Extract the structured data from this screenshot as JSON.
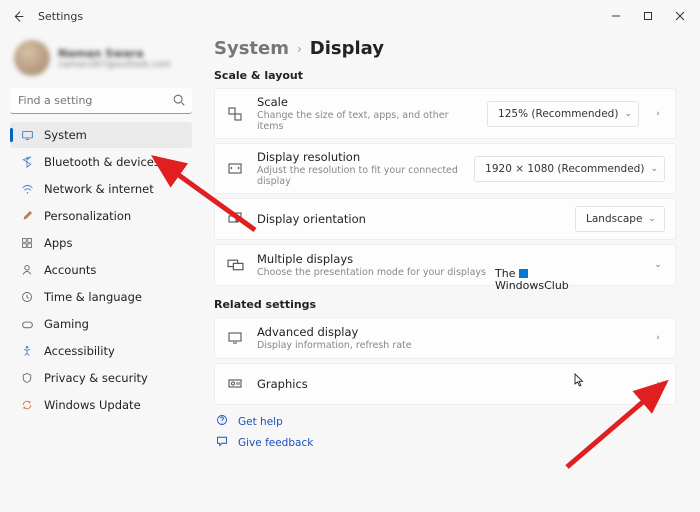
{
  "titlebar": {
    "title": "Settings"
  },
  "profile": {
    "name": "Naman Swara",
    "email": "naman267@outlook.com"
  },
  "search": {
    "placeholder": "Find a setting"
  },
  "nav": [
    {
      "label": "System"
    },
    {
      "label": "Bluetooth & devices"
    },
    {
      "label": "Network & internet"
    },
    {
      "label": "Personalization"
    },
    {
      "label": "Apps"
    },
    {
      "label": "Accounts"
    },
    {
      "label": "Time & language"
    },
    {
      "label": "Gaming"
    },
    {
      "label": "Accessibility"
    },
    {
      "label": "Privacy & security"
    },
    {
      "label": "Windows Update"
    }
  ],
  "breadcrumb": {
    "parent": "System",
    "current": "Display"
  },
  "sections": {
    "scale_layout": "Scale & layout",
    "related": "Related settings"
  },
  "cards": {
    "scale": {
      "title": "Scale",
      "sub": "Change the size of text, apps, and other items",
      "value": "125% (Recommended)"
    },
    "resolution": {
      "title": "Display resolution",
      "sub": "Adjust the resolution to fit your connected display",
      "value": "1920 × 1080 (Recommended)"
    },
    "orientation": {
      "title": "Display orientation",
      "value": "Landscape"
    },
    "multiple": {
      "title": "Multiple displays",
      "sub": "Choose the presentation mode for your displays"
    },
    "advanced": {
      "title": "Advanced display",
      "sub": "Display information, refresh rate"
    },
    "graphics": {
      "title": "Graphics"
    }
  },
  "footer": {
    "help": "Get help",
    "feedback": "Give feedback"
  },
  "watermark": {
    "line1": "The",
    "line2": "WindowsClub"
  }
}
